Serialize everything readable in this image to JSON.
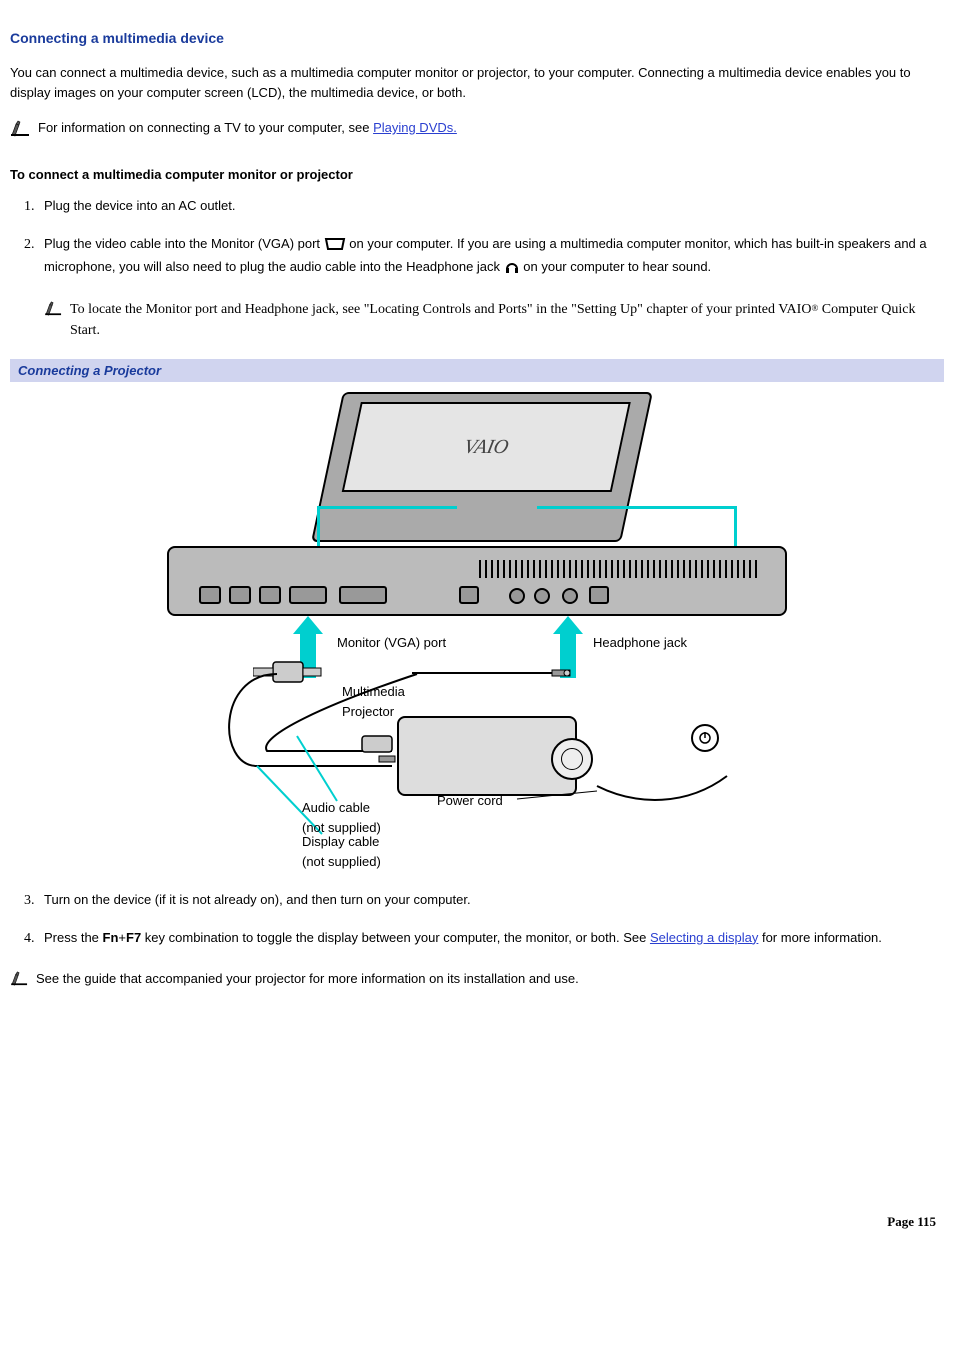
{
  "title": "Connecting a multimedia device",
  "intro": "You can connect a multimedia device, such as a multimedia computer monitor or projector, to your computer. Connecting a multimedia device enables you to display images on your computer screen (LCD), the multimedia device, or both.",
  "info_note_prefix": "For information on connecting a TV to your computer, see ",
  "info_note_link": "Playing DVDs.",
  "sub_heading": "To connect a multimedia computer monitor or projector",
  "steps": {
    "s1": "Plug the device into an AC outlet.",
    "s2_a": "Plug the video cable into the Monitor (VGA) port ",
    "s2_b": " on your computer. If you are using a multimedia computer monitor, which has built-in speakers and a microphone, you will also need to plug the audio cable into the Headphone jack ",
    "s2_c": " on your computer to hear sound.",
    "s2_note_a": "To locate the Monitor port and Headphone jack, see \"Locating Controls and Ports\" in the \"Setting Up\" chapter of your printed VAIO",
    "s2_note_b": " Computer Quick Start.",
    "s3": "Turn on the device (if it is not already on), and then turn on your computer.",
    "s4_a": "Press the ",
    "s4_fn": "Fn",
    "s4_plus": "+",
    "s4_f7": "F7",
    "s4_b": " key combination to toggle the display between your computer, the monitor, or both. See ",
    "s4_link": "Selecting a display",
    "s4_c": " for more information."
  },
  "figure": {
    "caption": "Connecting a Projector",
    "laptop_brand": "VAIO",
    "label_vga": "Monitor (VGA) port",
    "label_headphone": "Headphone jack",
    "label_projector_a": "Multimedia",
    "label_projector_b": "Projector",
    "label_power": "Power cord",
    "label_audio_a": "Audio cable",
    "label_audio_b": "(not supplied)",
    "label_display_a": "Display cable",
    "label_display_b": "(not supplied)"
  },
  "final_note": "See the guide that accompanied your projector for more information on its installation and use.",
  "page_number": "Page 115",
  "reg_mark": "®"
}
